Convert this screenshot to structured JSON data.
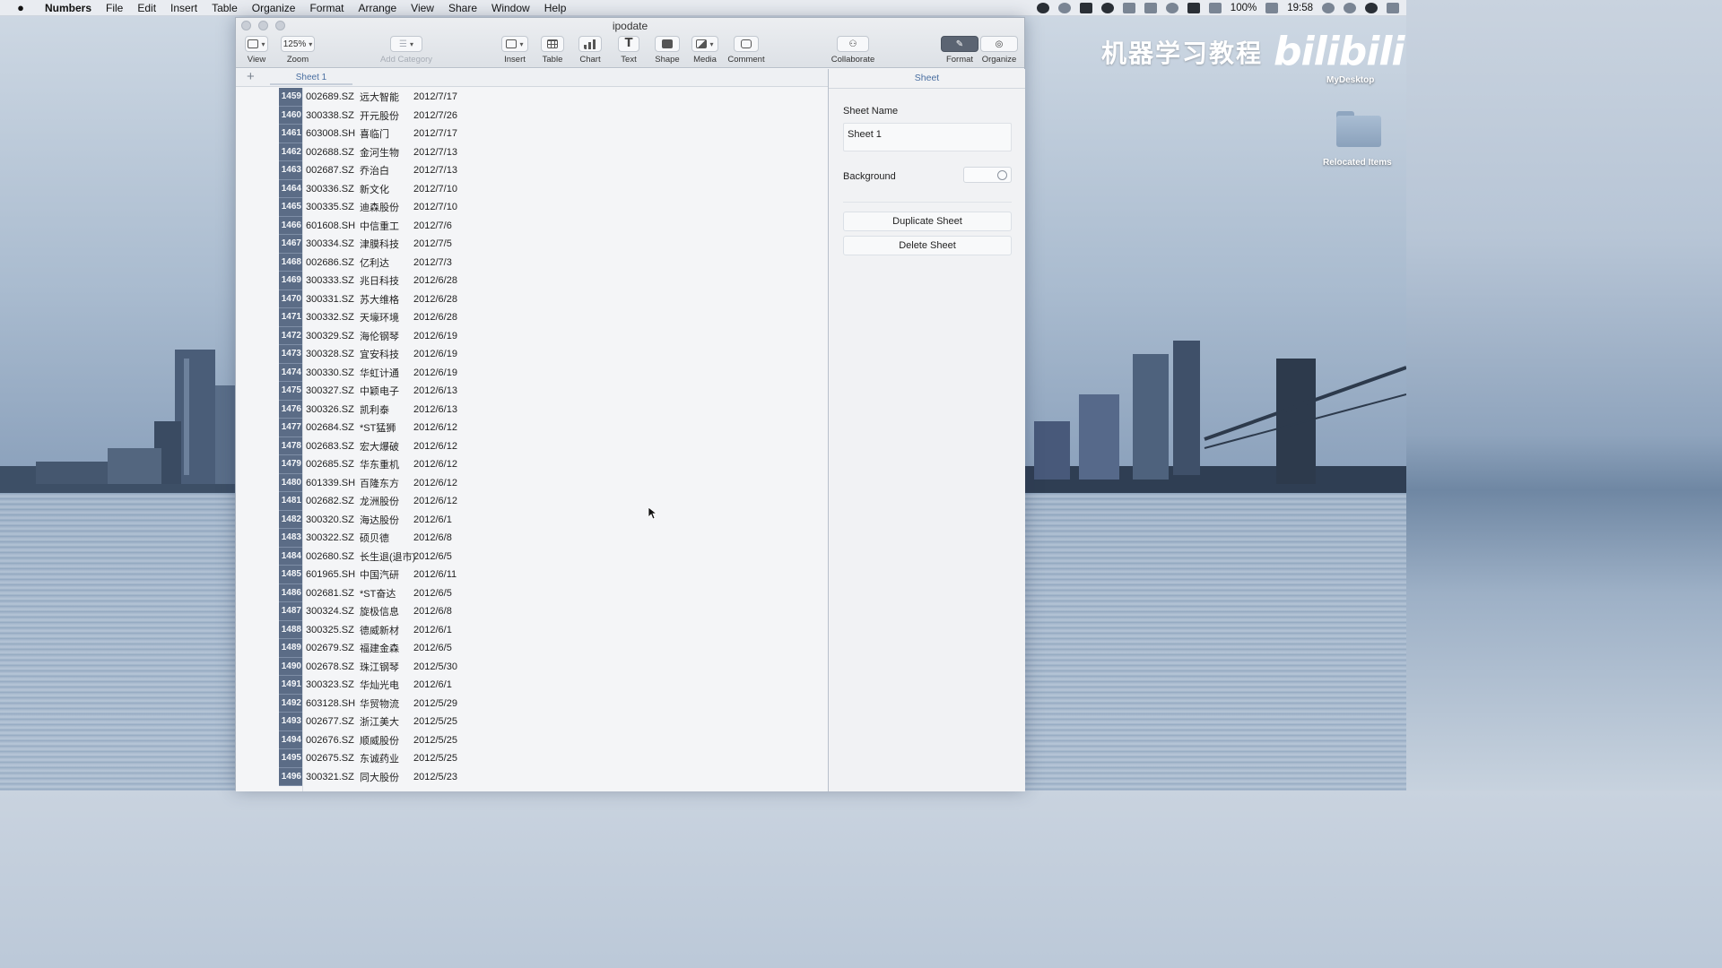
{
  "menubar": {
    "app_name": "Numbers",
    "items": [
      "File",
      "Edit",
      "Insert",
      "Table",
      "Organize",
      "Format",
      "Arrange",
      "View",
      "Share",
      "Window",
      "Help"
    ],
    "battery": "100%",
    "time": "19:58"
  },
  "window": {
    "title": "ipodate"
  },
  "toolbar": {
    "view_label": "View",
    "zoom_value": "125%",
    "zoom_label": "Zoom",
    "add_category_label": "Add Category",
    "insert_label": "Insert",
    "table_label": "Table",
    "chart_label": "Chart",
    "text_label": "Text",
    "text_glyph": "T",
    "shape_label": "Shape",
    "media_label": "Media",
    "comment_label": "Comment",
    "collaborate_label": "Collaborate",
    "format_label": "Format",
    "organize_label": "Organize"
  },
  "tabbar": {
    "add_symbol": "+",
    "sheet_tab": "Sheet 1"
  },
  "table": {
    "rows": [
      {
        "n": "1459",
        "code": "002689.SZ",
        "name": "远大智能",
        "date": "2012/7/17"
      },
      {
        "n": "1460",
        "code": "300338.SZ",
        "name": "开元股份",
        "date": "2012/7/26"
      },
      {
        "n": "1461",
        "code": "603008.SH",
        "name": "喜临门",
        "date": "2012/7/17"
      },
      {
        "n": "1462",
        "code": "002688.SZ",
        "name": "金河生物",
        "date": "2012/7/13"
      },
      {
        "n": "1463",
        "code": "002687.SZ",
        "name": "乔治白",
        "date": "2012/7/13"
      },
      {
        "n": "1464",
        "code": "300336.SZ",
        "name": "新文化",
        "date": "2012/7/10"
      },
      {
        "n": "1465",
        "code": "300335.SZ",
        "name": "迪森股份",
        "date": "2012/7/10"
      },
      {
        "n": "1466",
        "code": "601608.SH",
        "name": "中信重工",
        "date": "2012/7/6"
      },
      {
        "n": "1467",
        "code": "300334.SZ",
        "name": "津膜科技",
        "date": "2012/7/5"
      },
      {
        "n": "1468",
        "code": "002686.SZ",
        "name": "亿利达",
        "date": "2012/7/3"
      },
      {
        "n": "1469",
        "code": "300333.SZ",
        "name": "兆日科技",
        "date": "2012/6/28"
      },
      {
        "n": "1470",
        "code": "300331.SZ",
        "name": "苏大维格",
        "date": "2012/6/28"
      },
      {
        "n": "1471",
        "code": "300332.SZ",
        "name": "天壕环境",
        "date": "2012/6/28"
      },
      {
        "n": "1472",
        "code": "300329.SZ",
        "name": "海伦钢琴",
        "date": "2012/6/19"
      },
      {
        "n": "1473",
        "code": "300328.SZ",
        "name": "宜安科技",
        "date": "2012/6/19"
      },
      {
        "n": "1474",
        "code": "300330.SZ",
        "name": "华虹计通",
        "date": "2012/6/19"
      },
      {
        "n": "1475",
        "code": "300327.SZ",
        "name": "中颖电子",
        "date": "2012/6/13"
      },
      {
        "n": "1476",
        "code": "300326.SZ",
        "name": "凯利泰",
        "date": "2012/6/13"
      },
      {
        "n": "1477",
        "code": "002684.SZ",
        "name": "*ST猛狮",
        "date": "2012/6/12"
      },
      {
        "n": "1478",
        "code": "002683.SZ",
        "name": "宏大爆破",
        "date": "2012/6/12"
      },
      {
        "n": "1479",
        "code": "002685.SZ",
        "name": "华东重机",
        "date": "2012/6/12"
      },
      {
        "n": "1480",
        "code": "601339.SH",
        "name": "百隆东方",
        "date": "2012/6/12"
      },
      {
        "n": "1481",
        "code": "002682.SZ",
        "name": "龙洲股份",
        "date": "2012/6/12"
      },
      {
        "n": "1482",
        "code": "300320.SZ",
        "name": "海达股份",
        "date": "2012/6/1"
      },
      {
        "n": "1483",
        "code": "300322.SZ",
        "name": "硕贝德",
        "date": "2012/6/8"
      },
      {
        "n": "1484",
        "code": "002680.SZ",
        "name": "长生退(退市)",
        "date": "2012/6/5"
      },
      {
        "n": "1485",
        "code": "601965.SH",
        "name": "中国汽研",
        "date": "2012/6/11"
      },
      {
        "n": "1486",
        "code": "002681.SZ",
        "name": "*ST奋达",
        "date": "2012/6/5"
      },
      {
        "n": "1487",
        "code": "300324.SZ",
        "name": "旋极信息",
        "date": "2012/6/8"
      },
      {
        "n": "1488",
        "code": "300325.SZ",
        "name": "德威新材",
        "date": "2012/6/1"
      },
      {
        "n": "1489",
        "code": "002679.SZ",
        "name": "福建金森",
        "date": "2012/6/5"
      },
      {
        "n": "1490",
        "code": "002678.SZ",
        "name": "珠江钢琴",
        "date": "2012/5/30"
      },
      {
        "n": "1491",
        "code": "300323.SZ",
        "name": "华灿光电",
        "date": "2012/6/1"
      },
      {
        "n": "1492",
        "code": "603128.SH",
        "name": "华贸物流",
        "date": "2012/5/29"
      },
      {
        "n": "1493",
        "code": "002677.SZ",
        "name": "浙江美大",
        "date": "2012/5/25"
      },
      {
        "n": "1494",
        "code": "002676.SZ",
        "name": "顺威股份",
        "date": "2012/5/25"
      },
      {
        "n": "1495",
        "code": "002675.SZ",
        "name": "东诚药业",
        "date": "2012/5/25"
      },
      {
        "n": "1496",
        "code": "300321.SZ",
        "name": "同大股份",
        "date": "2012/5/23"
      }
    ]
  },
  "inspector": {
    "tab": "Sheet",
    "sheet_name_label": "Sheet Name",
    "sheet_name_value": "Sheet 1",
    "background_label": "Background",
    "duplicate_button": "Duplicate Sheet",
    "delete_button": "Delete Sheet"
  },
  "desktop": {
    "brand_text": "机器学习教程",
    "brand_logo": "bilibili",
    "mydesktop_label": "MyDesktop",
    "folder_label": "Relocated Items"
  },
  "colors": {
    "row_header": "#5b6c86",
    "accent": "#4a6fa1",
    "active_tool": "#5b6472"
  }
}
